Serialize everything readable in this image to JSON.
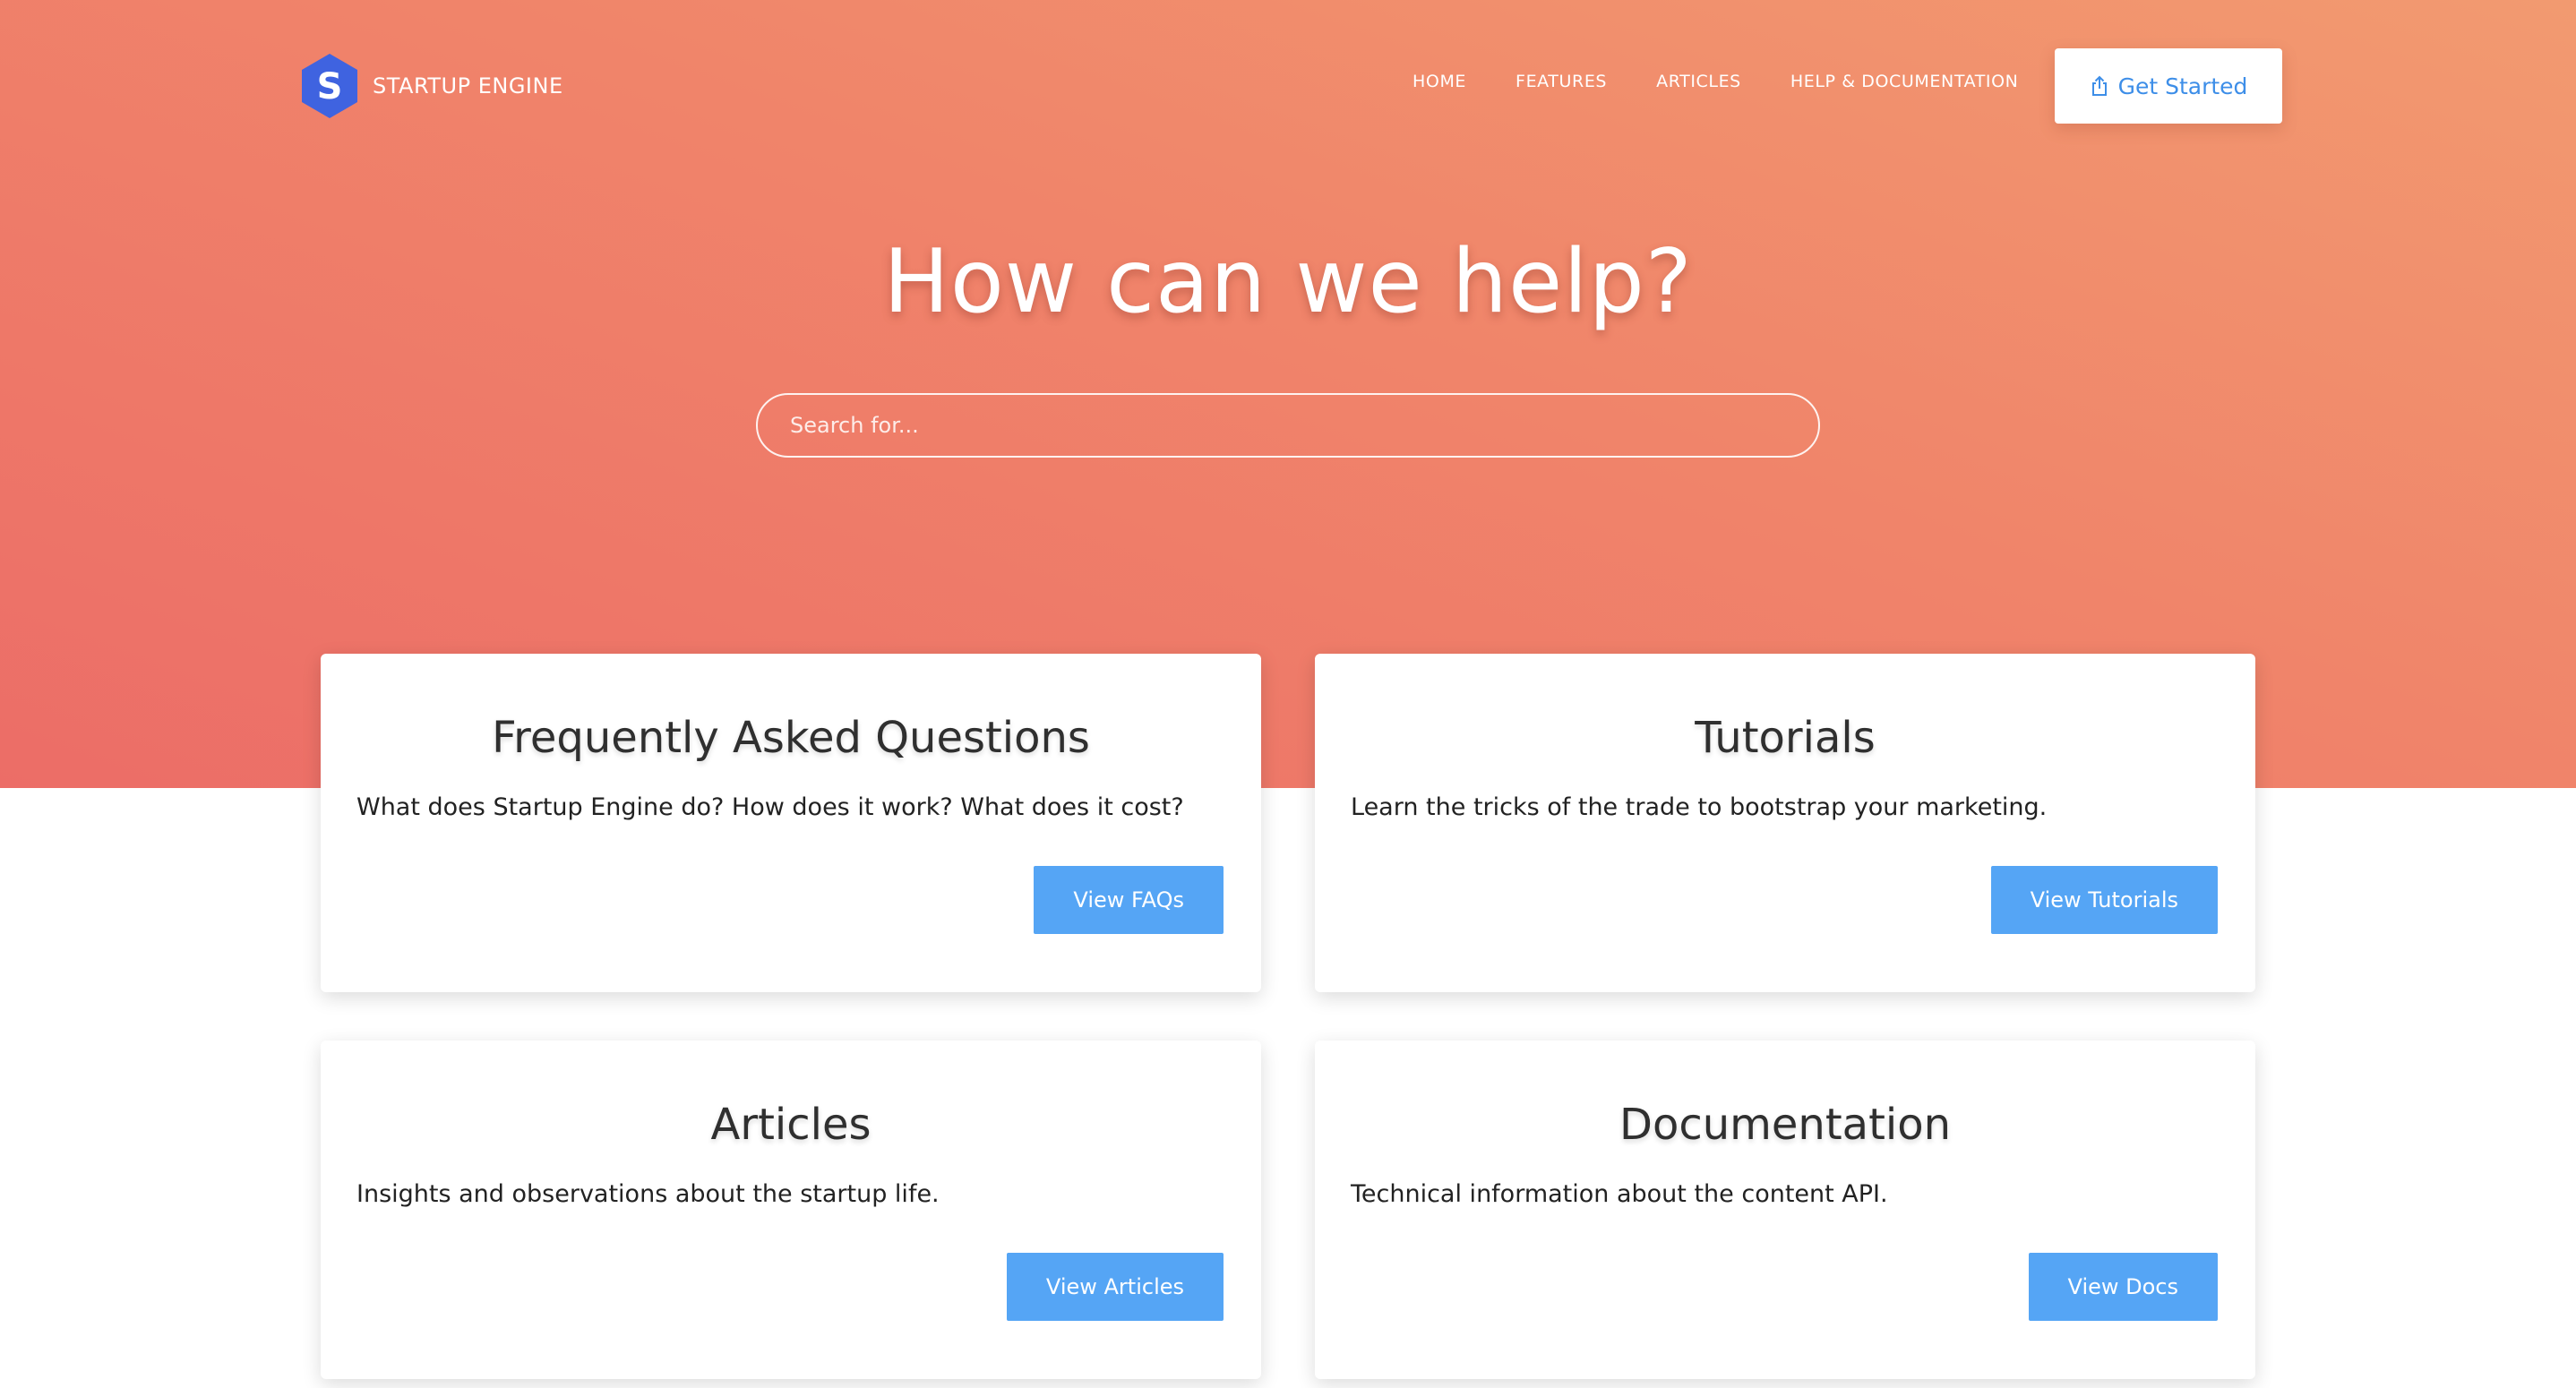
{
  "brand": {
    "logo_letter": "S",
    "name": "STARTUP ENGINE"
  },
  "nav": {
    "items": [
      {
        "label": "HOME"
      },
      {
        "label": "FEATURES"
      },
      {
        "label": "ARTICLES"
      },
      {
        "label": "HELP & DOCUMENTATION"
      }
    ],
    "cta_label": "Get Started",
    "cta_icon": "share-icon"
  },
  "hero": {
    "title": "How can we help?",
    "search_placeholder": "Search for..."
  },
  "cards": [
    {
      "title": "Frequently Asked Questions",
      "description": "What does Startup Engine do? How does it work? What does it cost?",
      "button": "View FAQs"
    },
    {
      "title": "Tutorials",
      "description": "Learn the tricks of the trade to bootstrap your marketing.",
      "button": "View Tutorials"
    },
    {
      "title": "Articles",
      "description": "Insights and observations about the startup life.",
      "button": "View Articles"
    },
    {
      "title": "Documentation",
      "description": "Technical information about the content API.",
      "button": "View Docs"
    }
  ],
  "colors": {
    "hero_gradient_top": "#f29a70",
    "hero_gradient_bottom": "#ec6d67",
    "logo_blue": "#3f63e0",
    "button_blue": "#55a5f5",
    "cta_text": "#3d8ee8"
  }
}
